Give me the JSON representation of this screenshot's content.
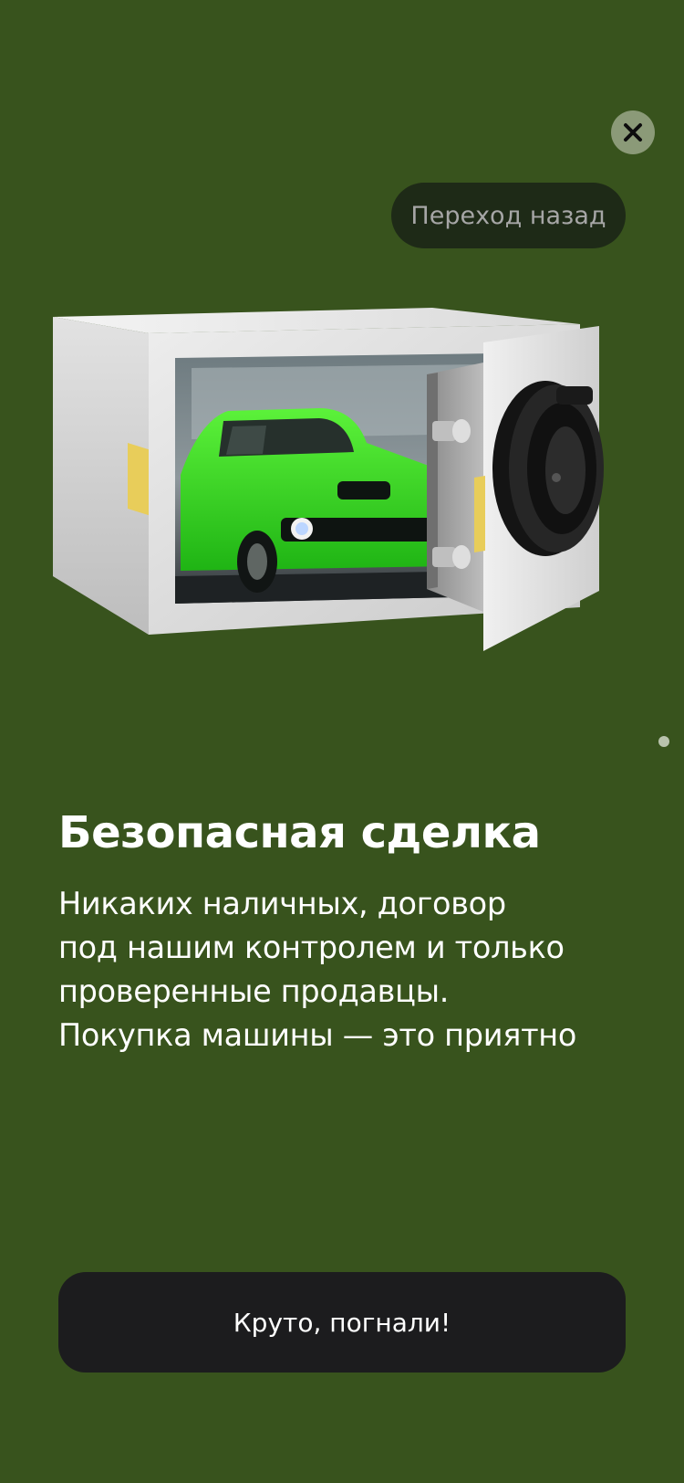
{
  "colors": {
    "background": "#38531d",
    "close_button": "#8b9a78",
    "back_pill": "#1e2a17",
    "cta_button": "#1c1c1e",
    "car_accent": "#33e020"
  },
  "header": {
    "close_icon": "close-icon",
    "back_label": "Переход назад"
  },
  "illustration": {
    "icon": "safe-with-car-illustration"
  },
  "pager": {
    "current": 1
  },
  "content": {
    "title": "Безопасная сделка",
    "description_lines": [
      "Никаких наличных, договор",
      "под нашим контролем и только",
      "проверенные продавцы.",
      "Покупка машины — это приятно"
    ]
  },
  "footer": {
    "cta_label": "Круто, погнали!"
  }
}
